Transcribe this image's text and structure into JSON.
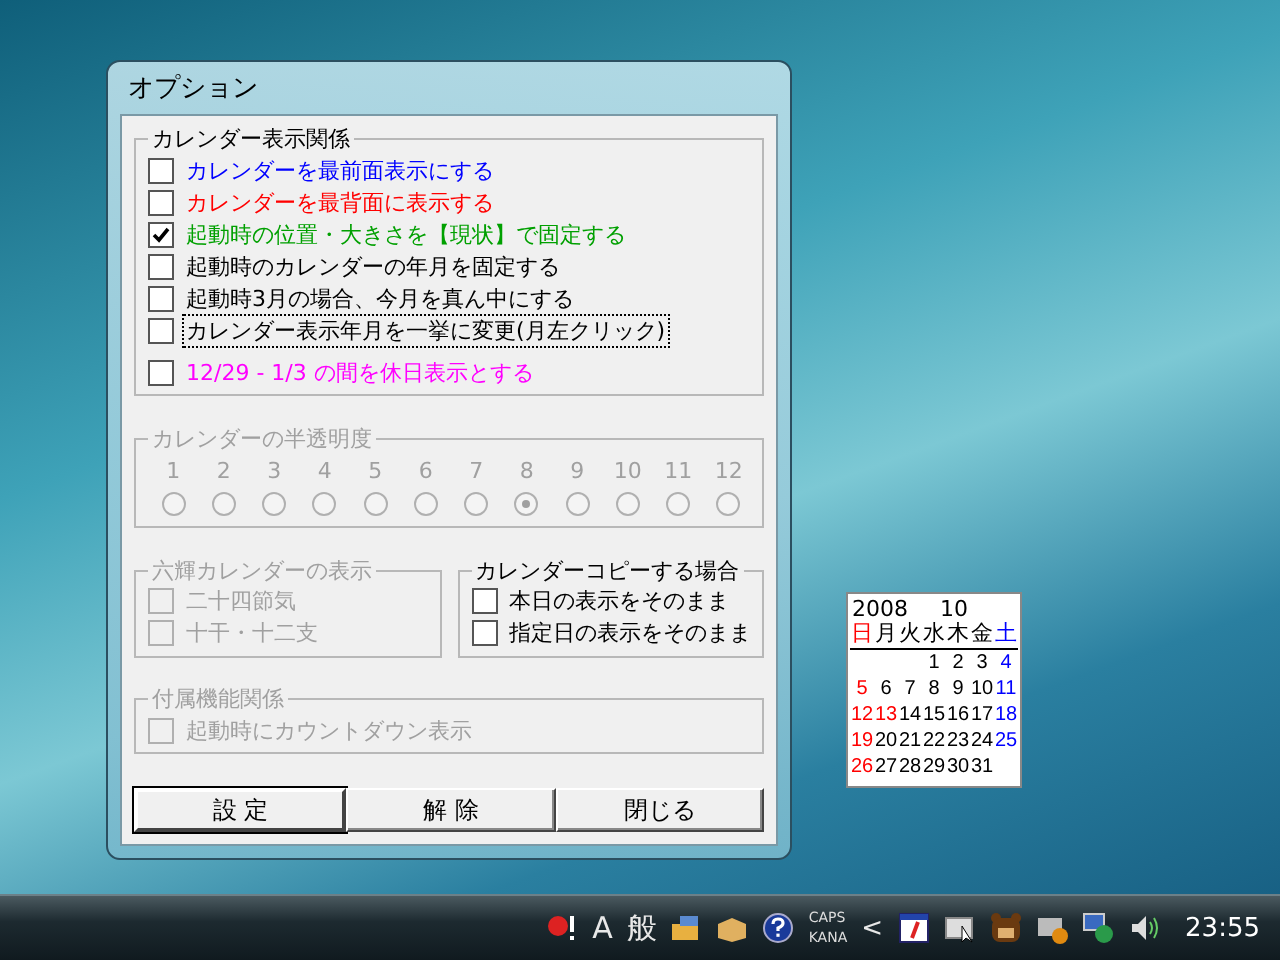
{
  "window": {
    "title": "オプション"
  },
  "display_group": {
    "title": "カレンダー表示関係",
    "items": [
      {
        "label": "カレンダーを最前面表示にする",
        "checked": false,
        "focused": false,
        "color": "#0000ff"
      },
      {
        "label": "カレンダーを最背面に表示する",
        "checked": false,
        "focused": false,
        "color": "#ff0000"
      },
      {
        "label": "起動時の位置・大きさを【現状】で固定する",
        "checked": true,
        "focused": false,
        "color": "#00a000"
      },
      {
        "label": "起動時のカレンダーの年月を固定する",
        "checked": false,
        "focused": false,
        "color": "#000000"
      },
      {
        "label": "起動時3月の場合、今月を真ん中にする",
        "checked": false,
        "focused": false,
        "color": "#000000"
      },
      {
        "label": "カレンダー表示年月を一挙に変更(月左クリック)",
        "checked": false,
        "focused": true,
        "color": "#000000"
      },
      {
        "label": "12/29 - 1/3 の間を休日表示とする",
        "checked": false,
        "focused": false,
        "color": "#ff00ff"
      }
    ]
  },
  "transparency_group": {
    "title": "カレンダーの半透明度",
    "disabled": true,
    "options": [
      {
        "label": "1",
        "selected": false
      },
      {
        "label": "2",
        "selected": false
      },
      {
        "label": "3",
        "selected": false
      },
      {
        "label": "4",
        "selected": false
      },
      {
        "label": "5",
        "selected": false
      },
      {
        "label": "6",
        "selected": false
      },
      {
        "label": "7",
        "selected": false
      },
      {
        "label": "8",
        "selected": true
      },
      {
        "label": "9",
        "selected": false
      },
      {
        "label": "10",
        "selected": false
      },
      {
        "label": "11",
        "selected": false
      },
      {
        "label": "12",
        "selected": false
      }
    ]
  },
  "rokuyo_group": {
    "title": "六輝カレンダーの表示",
    "disabled": true,
    "items": [
      {
        "label": "二十四節気",
        "checked": false
      },
      {
        "label": "十干・十二支",
        "checked": false
      }
    ]
  },
  "copy_group": {
    "title": "カレンダーコピーする場合",
    "disabled": false,
    "items": [
      {
        "label": "本日の表示をそのまま",
        "checked": false
      },
      {
        "label": "指定日の表示をそのまま",
        "checked": false
      }
    ]
  },
  "extras_group": {
    "title": "付属機能関係",
    "disabled": true,
    "items": [
      {
        "label": "起動時にカウントダウン表示",
        "checked": false
      }
    ]
  },
  "buttons": [
    {
      "label": "設 定",
      "default": true
    },
    {
      "label": "解 除",
      "default": false
    },
    {
      "label": "閉じる",
      "default": false
    }
  ],
  "calendar": {
    "year": "2008",
    "month": "10",
    "weekdays": [
      {
        "text": "日",
        "color": "#ff0000"
      },
      {
        "text": "月",
        "color": "#000000"
      },
      {
        "text": "火",
        "color": "#000000"
      },
      {
        "text": "水",
        "color": "#000000"
      },
      {
        "text": "木",
        "color": "#000000"
      },
      {
        "text": "金",
        "color": "#000000"
      },
      {
        "text": "土",
        "color": "#0000ff"
      }
    ],
    "weeks": [
      {
        "kind": "first",
        "days": [
          {
            "text": "1",
            "color": "#000000"
          },
          {
            "text": "2",
            "color": "#000000"
          },
          {
            "text": "3",
            "color": "#000000"
          },
          {
            "text": "4",
            "color": "#0000ff"
          }
        ]
      },
      {
        "kind": "full",
        "days": [
          {
            "text": "5",
            "color": "#ff0000"
          },
          {
            "text": "6",
            "color": "#000000"
          },
          {
            "text": "7",
            "color": "#000000"
          },
          {
            "text": "8",
            "color": "#000000"
          },
          {
            "text": "9",
            "color": "#000000"
          },
          {
            "text": "10",
            "color": "#000000"
          },
          {
            "text": "11",
            "color": "#0000ff"
          }
        ]
      },
      {
        "kind": "full",
        "days": [
          {
            "text": "12",
            "color": "#ff0000"
          },
          {
            "text": "13",
            "color": "#ff0000"
          },
          {
            "text": "14",
            "color": "#000000"
          },
          {
            "text": "15",
            "color": "#000000"
          },
          {
            "text": "16",
            "color": "#000000"
          },
          {
            "text": "17",
            "color": "#000000"
          },
          {
            "text": "18",
            "color": "#0000ff"
          }
        ]
      },
      {
        "kind": "full",
        "days": [
          {
            "text": "19",
            "color": "#ff0000"
          },
          {
            "text": "20",
            "color": "#000000"
          },
          {
            "text": "21",
            "color": "#000000"
          },
          {
            "text": "22",
            "color": "#000000"
          },
          {
            "text": "23",
            "color": "#000000"
          },
          {
            "text": "24",
            "color": "#000000"
          },
          {
            "text": "25",
            "color": "#0000ff"
          }
        ]
      },
      {
        "kind": "last",
        "days": [
          {
            "text": "26",
            "color": "#ff0000"
          },
          {
            "text": "27",
            "color": "#000000"
          },
          {
            "text": "28",
            "color": "#000000"
          },
          {
            "text": "29",
            "color": "#000000"
          },
          {
            "text": "30",
            "color": "#000000"
          },
          {
            "text": "31",
            "color": "#000000"
          }
        ]
      }
    ]
  },
  "taskbar": {
    "ime_mode": "A",
    "ime_input": "般",
    "caps": "CAPS",
    "kana": "KANA",
    "chevron": "<",
    "clock": "23:55"
  }
}
